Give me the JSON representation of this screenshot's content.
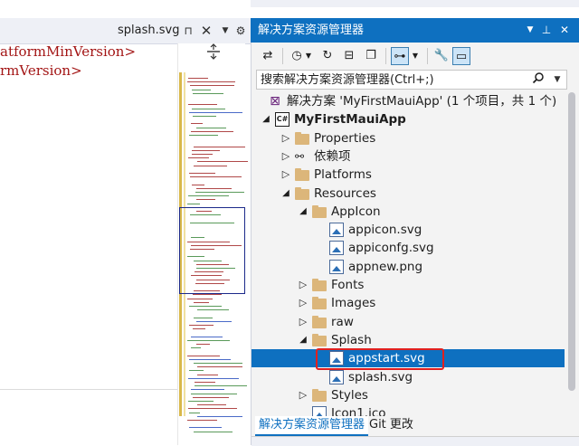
{
  "editor": {
    "tab_name": "splash.svg",
    "lines": [
      "atformMinVersion>",
      "rmVersion>"
    ]
  },
  "panel": {
    "title": "解决方案资源管理器",
    "search_placeholder": "搜索解决方案资源管理器(Ctrl+;)",
    "accent": "#0e70c0",
    "tree": [
      {
        "label": "解决方案 'MyFirstMauiApp' (1 个项目，共 1 个)",
        "icon": "solution-icon",
        "level": 0,
        "expander": "none"
      },
      {
        "label": "MyFirstMauiApp",
        "icon": "csharp-project-icon",
        "level": 0,
        "expander": "expanded",
        "bold": true
      },
      {
        "label": "Properties",
        "icon": "folder-icon",
        "level": 1,
        "expander": "collapsed"
      },
      {
        "label": "依赖项",
        "icon": "dependencies-icon",
        "level": 1,
        "expander": "collapsed"
      },
      {
        "label": "Platforms",
        "icon": "folder-icon",
        "level": 1,
        "expander": "collapsed"
      },
      {
        "label": "Resources",
        "icon": "folder-icon",
        "level": 1,
        "expander": "expanded"
      },
      {
        "label": "AppIcon",
        "icon": "folder-icon",
        "level": 2,
        "expander": "expanded"
      },
      {
        "label": "appicon.svg",
        "icon": "image-file-icon",
        "level": 3,
        "expander": "none"
      },
      {
        "label": "appiconfg.svg",
        "icon": "image-file-icon",
        "level": 3,
        "expander": "none"
      },
      {
        "label": "appnew.png",
        "icon": "image-file-icon",
        "level": 3,
        "expander": "none"
      },
      {
        "label": "Fonts",
        "icon": "folder-icon",
        "level": 2,
        "expander": "collapsed"
      },
      {
        "label": "Images",
        "icon": "folder-icon",
        "level": 2,
        "expander": "collapsed"
      },
      {
        "label": "raw",
        "icon": "folder-icon",
        "level": 2,
        "expander": "collapsed"
      },
      {
        "label": "Splash",
        "icon": "folder-icon",
        "level": 2,
        "expander": "expanded"
      },
      {
        "label": "appstart.svg",
        "icon": "image-file-icon",
        "level": 3,
        "expander": "none",
        "selected": true
      },
      {
        "label": "splash.svg",
        "icon": "image-file-icon",
        "level": 3,
        "expander": "none"
      },
      {
        "label": "Styles",
        "icon": "folder-icon",
        "level": 2,
        "expander": "collapsed"
      },
      {
        "label": "Icon1.ico",
        "icon": "image-file-icon",
        "level": 2,
        "expander": "none"
      }
    ],
    "bottom_tabs": [
      "解决方案资源管理器",
      "Git 更改"
    ]
  }
}
